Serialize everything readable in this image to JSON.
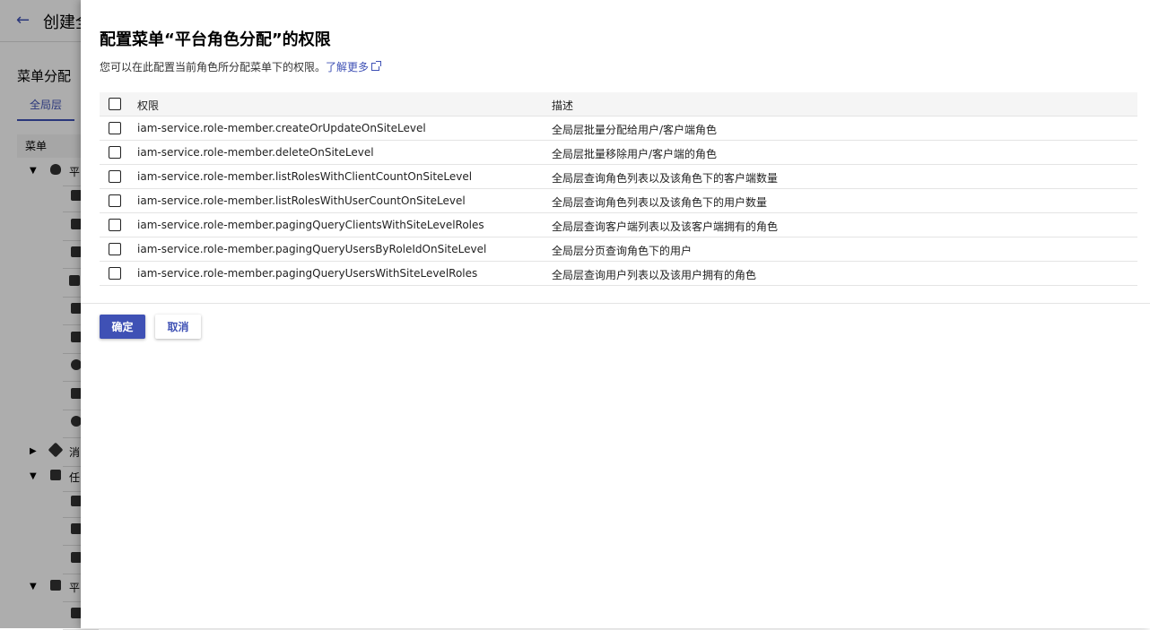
{
  "background": {
    "title_partial": "创建全",
    "section_title": "菜单分配",
    "active_tab": "全局层",
    "table_header": "菜单",
    "tree_fragments": [
      "平",
      "消",
      "任",
      "平"
    ]
  },
  "dialog": {
    "title": "配置菜单“平台角色分配”的权限",
    "description": "您可以在此配置当前角色所分配菜单下的权限。",
    "learn_more": "了解更多",
    "columns": {
      "permission": "权限",
      "description": "描述"
    },
    "rows": [
      {
        "permission": "iam-service.role-member.createOrUpdateOnSiteLevel",
        "description": "全局层批量分配给用户/客户端角色"
      },
      {
        "permission": "iam-service.role-member.deleteOnSiteLevel",
        "description": "全局层批量移除用户/客户端的角色"
      },
      {
        "permission": "iam-service.role-member.listRolesWithClientCountOnSiteLevel",
        "description": "全局层查询角色列表以及该角色下的客户端数量"
      },
      {
        "permission": "iam-service.role-member.listRolesWithUserCountOnSiteLevel",
        "description": "全局层查询角色列表以及该角色下的用户数量"
      },
      {
        "permission": "iam-service.role-member.pagingQueryClientsWithSiteLevelRoles",
        "description": "全局层查询客户端列表以及该客户端拥有的角色"
      },
      {
        "permission": "iam-service.role-member.pagingQueryUsersByRoleIdOnSiteLevel",
        "description": "全局层分页查询角色下的用户"
      },
      {
        "permission": "iam-service.role-member.pagingQueryUsersWithSiteLevelRoles",
        "description": "全局层查询用户列表以及该用户拥有的角色"
      }
    ],
    "ok_label": "确定",
    "cancel_label": "取消"
  },
  "colors": {
    "primary": "#3f51b5"
  }
}
